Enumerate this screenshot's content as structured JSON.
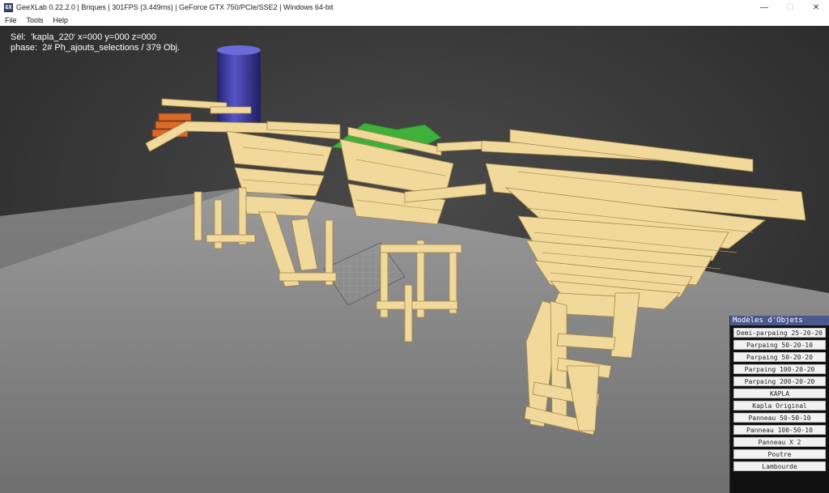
{
  "window": {
    "title": "GeeXLab 0.22.2.0 | Briques | 301FPS (3.449ms) | GeForce GTX 750/PCIe/SSE2 | Windows 64-bit",
    "icon_name": "geexlab-app-icon"
  },
  "menu": [
    {
      "label": "File"
    },
    {
      "label": "Tools"
    },
    {
      "label": "Help"
    }
  ],
  "viewport": {
    "selection_line": "Sél:  'kapla_220' x=000 y=000 z=000",
    "phase_line": "phase:  2# Ph_ajouts_selections / 379 Obj.",
    "colors": {
      "background": "#3a3a3a",
      "floor": "#8c8c8c",
      "wood": "#f0d99a",
      "cylinder": "#3a3aa0",
      "foliage": "#3fb13a",
      "brick": "#d86a2a"
    }
  },
  "panel": {
    "title": "Modèles d'Objets",
    "buttons": [
      "Demi-parpaing 25-20-20",
      "Parpaing 50-20-10",
      "Parpaing 50-20-20",
      "Parpaing 100-20-20",
      "Parpaing 200-20-20",
      "KAPLA",
      "Kapla Original",
      "Panneau 50-50-10",
      "Panneau 100-50-10",
      "Panneau X 2",
      "Poutre",
      "Lambourde"
    ]
  }
}
